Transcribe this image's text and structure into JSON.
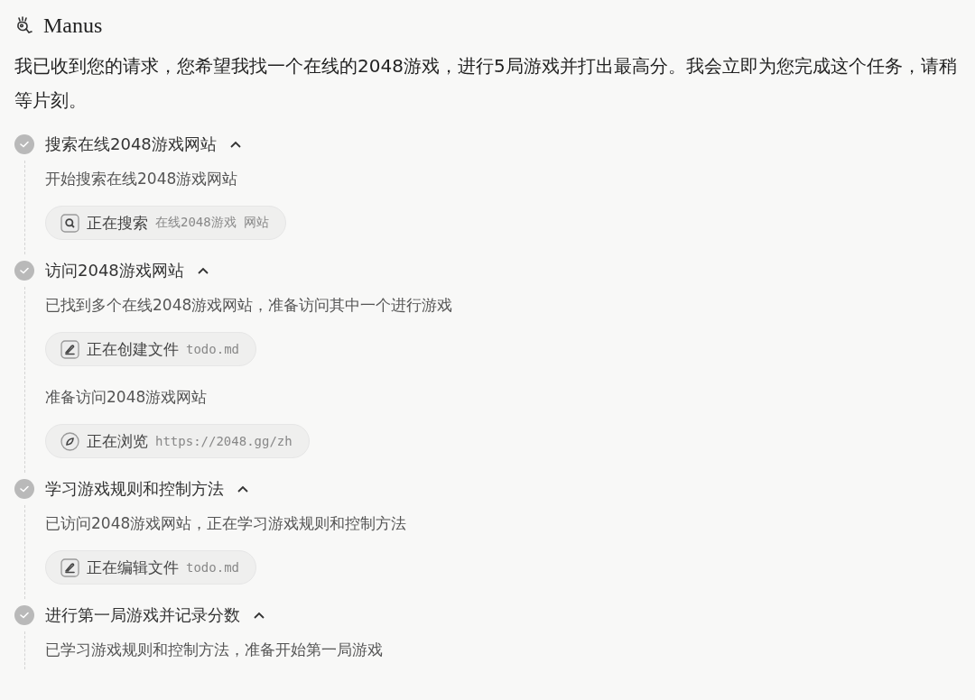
{
  "header": {
    "title": "Manus"
  },
  "message": "我已收到您的请求，您希望我找一个在线的2048游戏，进行5局游戏并打出最高分。我会立即为您完成这个任务，请稍等片刻。",
  "steps": [
    {
      "title": "搜索在线2048游戏网站",
      "done": true,
      "expanded": true,
      "items": [
        {
          "kind": "note",
          "text": "开始搜索在线2048游戏网站"
        },
        {
          "kind": "search",
          "verb": "正在搜索",
          "arg": "在线2048游戏 网站"
        }
      ]
    },
    {
      "title": "访问2048游戏网站",
      "done": true,
      "expanded": true,
      "items": [
        {
          "kind": "note",
          "text": "已找到多个在线2048游戏网站，准备访问其中一个进行游戏"
        },
        {
          "kind": "edit",
          "verb": "正在创建文件",
          "arg": "todo.md"
        },
        {
          "kind": "note",
          "text": "准备访问2048游戏网站"
        },
        {
          "kind": "browse",
          "verb": "正在浏览",
          "arg": "https://2048.gg/zh"
        }
      ]
    },
    {
      "title": "学习游戏规则和控制方法",
      "done": true,
      "expanded": true,
      "items": [
        {
          "kind": "note",
          "text": "已访问2048游戏网站，正在学习游戏规则和控制方法"
        },
        {
          "kind": "edit",
          "verb": "正在编辑文件",
          "arg": "todo.md"
        }
      ]
    },
    {
      "title": "进行第一局游戏并记录分数",
      "done": true,
      "expanded": true,
      "items": [
        {
          "kind": "note",
          "text": "已学习游戏规则和控制方法，准备开始第一局游戏"
        }
      ]
    }
  ]
}
